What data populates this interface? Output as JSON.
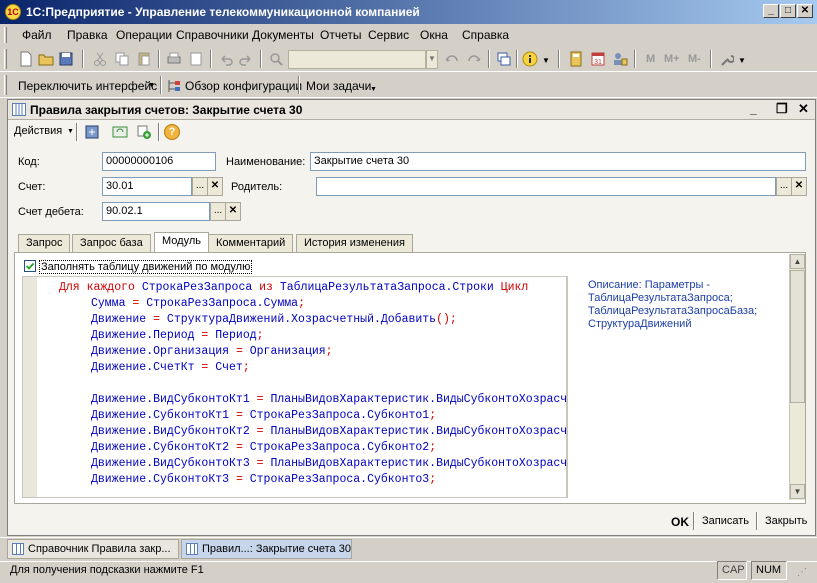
{
  "app": {
    "title": "1С:Предприятие - Управление телекоммуникационной компанией",
    "icon_text": "1С"
  },
  "menu": {
    "items": [
      "Файл",
      "Правка",
      "Операции",
      "Справочники",
      "Документы",
      "Отчеты",
      "Сервис",
      "Окна",
      "Справка"
    ],
    "underline_first": [
      "Ф",
      "П",
      "",
      "",
      "",
      "",
      "С",
      "О",
      "С"
    ]
  },
  "toolbar2": {
    "switch_interface": "Переключить интерфейс",
    "config_overview": "Обзор конфигурации",
    "my_tasks": "Мои задачи"
  },
  "toolbar1": {
    "memory_m": "M",
    "memory_mplus": "M+",
    "memory_mminus": "M-"
  },
  "window": {
    "title": "Правила закрытия счетов: Закрытие счета 30",
    "actions": "Действия",
    "help_icon_text": "?"
  },
  "form": {
    "code_label": "Код:",
    "code_value": "00000000106",
    "name_label": "Наименование:",
    "name_value": "Закрытие счета 30",
    "account_label": "Счет:",
    "account_value": "30.01",
    "parent_label": "Родитель:",
    "parent_value": "",
    "debit_label": "Счет дебета:",
    "debit_value": "90.02.1",
    "ellipsis": "...",
    "clear": "✕"
  },
  "tabs": [
    "Запрос",
    "Запрос база",
    "Модуль",
    "Комментарий",
    "История изменения"
  ],
  "module": {
    "checkbox_label": "Заполнять таблицу движений по модулю",
    "checkbox_checked": true,
    "code_lines": [
      {
        "indent": 0,
        "parts": [
          {
            "t": "Для каждого",
            "c": "kw"
          },
          {
            "t": " СтрокаРезЗапроса ",
            "c": "id"
          },
          {
            "t": "из",
            "c": "kw"
          },
          {
            "t": " ТаблицаРезультатаЗапроса.Строки ",
            "c": "id"
          },
          {
            "t": "Цикл",
            "c": "kw"
          }
        ]
      },
      {
        "indent": 1,
        "parts": [
          {
            "t": "Сумма ",
            "c": "id"
          },
          {
            "t": "=",
            "c": "op"
          },
          {
            "t": " СтрокаРезЗапроса.Сумма",
            "c": "id"
          },
          {
            "t": ";",
            "c": "op"
          }
        ]
      },
      {
        "indent": 1,
        "parts": [
          {
            "t": "Движение ",
            "c": "id"
          },
          {
            "t": "=",
            "c": "op"
          },
          {
            "t": " СтруктураДвижений.Хозрасчетный.Добавить",
            "c": "id"
          },
          {
            "t": "();",
            "c": "op"
          }
        ]
      },
      {
        "indent": 1,
        "parts": [
          {
            "t": "Движение.Период ",
            "c": "id"
          },
          {
            "t": "=",
            "c": "op"
          },
          {
            "t": " Период",
            "c": "id"
          },
          {
            "t": ";",
            "c": "op"
          }
        ]
      },
      {
        "indent": 1,
        "parts": [
          {
            "t": "Движение.Организация ",
            "c": "id"
          },
          {
            "t": "=",
            "c": "op"
          },
          {
            "t": " Организация",
            "c": "id"
          },
          {
            "t": ";",
            "c": "op"
          }
        ]
      },
      {
        "indent": 1,
        "parts": [
          {
            "t": "Движение.СчетКт ",
            "c": "id"
          },
          {
            "t": "=",
            "c": "op"
          },
          {
            "t": " Счет",
            "c": "id"
          },
          {
            "t": ";",
            "c": "op"
          }
        ]
      },
      {
        "indent": 1,
        "parts": []
      },
      {
        "indent": 1,
        "parts": [
          {
            "t": "Движение.ВидСубконтоКт1 ",
            "c": "id"
          },
          {
            "t": "=",
            "c": "op"
          },
          {
            "t": " ПланыВидовХарактеристик.ВидыСубконтоХозрасчетные",
            "c": "id"
          }
        ]
      },
      {
        "indent": 1,
        "parts": [
          {
            "t": "Движение.СубконтоКт1 ",
            "c": "id"
          },
          {
            "t": "=",
            "c": "op"
          },
          {
            "t": " СтрокаРезЗапроса.Субконто1",
            "c": "id"
          },
          {
            "t": ";",
            "c": "op"
          }
        ]
      },
      {
        "indent": 1,
        "parts": [
          {
            "t": "Движение.ВидСубконтоКт2 ",
            "c": "id"
          },
          {
            "t": "=",
            "c": "op"
          },
          {
            "t": " ПланыВидовХарактеристик.ВидыСубконтоХозрасчетные",
            "c": "id"
          }
        ]
      },
      {
        "indent": 1,
        "parts": [
          {
            "t": "Движение.СубконтоКт2 ",
            "c": "id"
          },
          {
            "t": "=",
            "c": "op"
          },
          {
            "t": " СтрокаРезЗапроса.Субконто2",
            "c": "id"
          },
          {
            "t": ";",
            "c": "op"
          }
        ]
      },
      {
        "indent": 1,
        "parts": [
          {
            "t": "Движение.ВидСубконтоКт3 ",
            "c": "id"
          },
          {
            "t": "=",
            "c": "op"
          },
          {
            "t": " ПланыВидовХарактеристик.ВидыСубконтоХозрасчетные",
            "c": "id"
          }
        ]
      },
      {
        "indent": 1,
        "parts": [
          {
            "t": "Движение.СубконтоКт3 ",
            "c": "id"
          },
          {
            "t": "=",
            "c": "op"
          },
          {
            "t": " СтрокаРезЗапроса.Субконто3",
            "c": "id"
          },
          {
            "t": ";",
            "c": "op"
          }
        ]
      }
    ],
    "description": "Описание: Параметры - ТаблицаРезультатаЗапроса; ТаблицаРезультатаЗапросаБаза; СтруктураДвижений"
  },
  "footer": {
    "ok": "OK",
    "save": "Записать",
    "close": "Закрыть"
  },
  "taskbar": {
    "items": [
      "Справочник Правила закр...",
      "Правил...: Закрытие счета 30"
    ]
  },
  "status": {
    "hint": "Для получения подсказки нажмите F1",
    "cap": "CAP",
    "num": "NUM"
  },
  "colors": {
    "keyword": "#d00000",
    "identifier": "#0000c0",
    "title_gradient_start": "#0a246a",
    "title_gradient_end": "#a6caf0"
  }
}
